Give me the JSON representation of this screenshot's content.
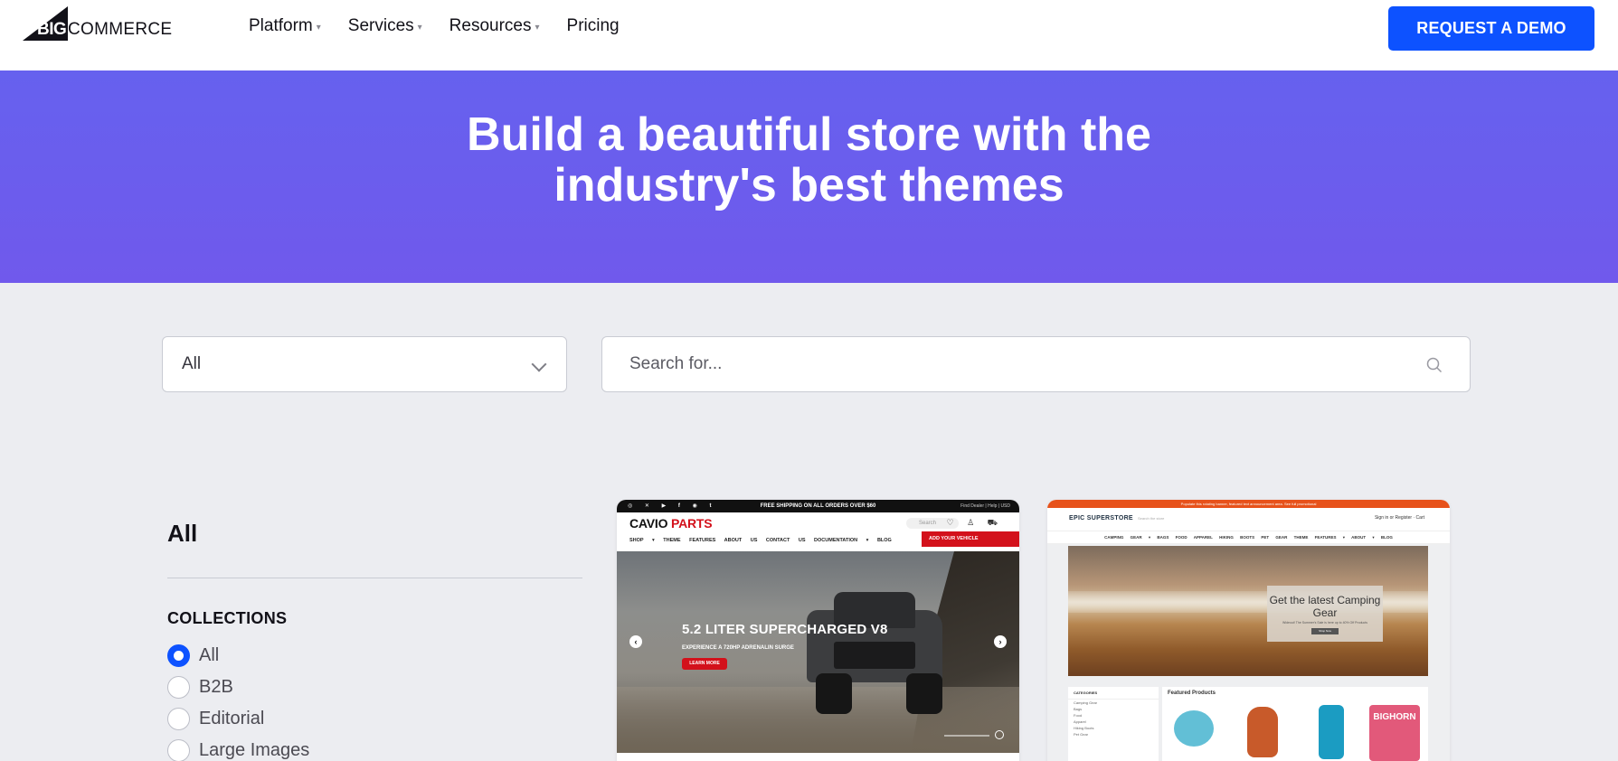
{
  "header": {
    "logo_big": "BIG",
    "logo_commerce": "COMMERCE",
    "nav": [
      {
        "label": "Platform",
        "has_dropdown": true
      },
      {
        "label": "Services",
        "has_dropdown": true
      },
      {
        "label": "Resources",
        "has_dropdown": true
      },
      {
        "label": "Pricing",
        "has_dropdown": false
      }
    ],
    "cta_label": "REQUEST A DEMO",
    "cta_color": "#0d52ff"
  },
  "hero": {
    "title_line1": "Build a beautiful store with the",
    "title_line2": "industry's best themes",
    "bg_color": "#6a5eee"
  },
  "filters": {
    "category_select_value": "All",
    "search_placeholder": "Search for..."
  },
  "sidebar": {
    "title": "All",
    "collections_heading": "COLLECTIONS",
    "collections": [
      {
        "label": "All",
        "selected": true
      },
      {
        "label": "B2B",
        "selected": false
      },
      {
        "label": "Editorial",
        "selected": false
      },
      {
        "label": "Large Images",
        "selected": false
      }
    ]
  },
  "cards": [
    {
      "announcement": "FREE SHIPPING ON ALL ORDERS OVER $60",
      "social_icons": "◎ ✕ ▶ f ◉ t",
      "utility": "Find Dealer  |  Help  |  USD",
      "logo_main": "CAVIO ",
      "logo_accent": "PARTS",
      "search_placeholder": "Search",
      "header_icons": "♡ ♙ ⛟",
      "menu": "SHOP ▾  THEME FEATURES  ABOUT US  CONTACT US  DOCUMENTATION ▾  BLOG",
      "vehicle_button": "ADD YOUR VEHICLE",
      "slide_title": "5.2 LITER SUPERCHARGED V8",
      "slide_subtitle": "EXPERIENCE A 720HP ADRENALIN SURGE",
      "slide_button": "LEARN MORE",
      "prev_arrow": "‹",
      "next_arrow": "›"
    },
    {
      "announcement": "Populate this rotating banner, featured text announcement area. See full promotional",
      "logo": "EPIC SUPERSTORE",
      "search_placeholder": "Search the store",
      "header_right": "Sign in or Register  ·  Cart",
      "menu": "CAMPING GEAR ▾  BAGS  FOOD  APPAREL  HIKING BOOTS  PET GEAR  THEME FEATURES ▾  ABOUT ▾  BLOG",
      "hero_title": "Get the latest Camping Gear",
      "hero_subtitle": "Wideout! The Summer's Sale is here up to 40% Off Products",
      "hero_button": "Shop Now",
      "categories_heading": "CATEGORIES",
      "categories": [
        "Camping Gear",
        "Bags",
        "Food",
        "Apparel",
        "Hiking Boots",
        "Pet Gear"
      ],
      "featured_heading": "Featured Products",
      "product_badge": "BIGHORN"
    }
  ]
}
